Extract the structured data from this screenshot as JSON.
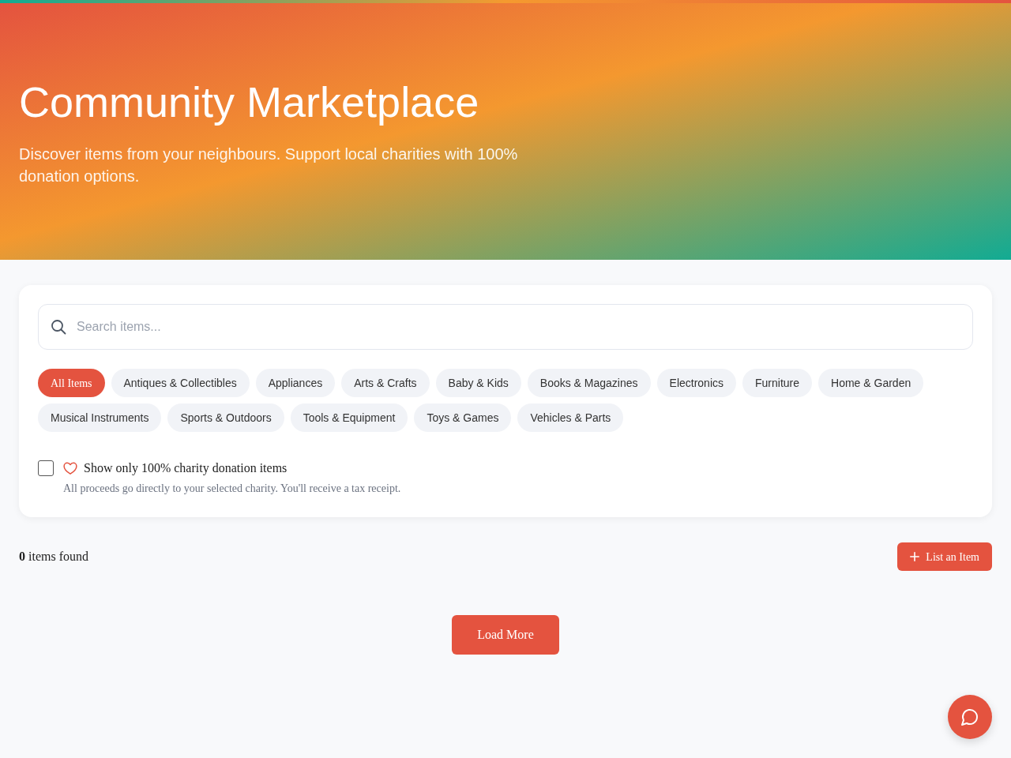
{
  "hero": {
    "title": "Community Marketplace",
    "subtitle": "Discover items from your neighbours. Support local charities with 100% donation options."
  },
  "search": {
    "placeholder": "Search items..."
  },
  "categories": [
    {
      "label": "All Items",
      "selected": true
    },
    {
      "label": "Antiques & Collectibles",
      "selected": false
    },
    {
      "label": "Appliances",
      "selected": false
    },
    {
      "label": "Arts & Crafts",
      "selected": false
    },
    {
      "label": "Baby & Kids",
      "selected": false
    },
    {
      "label": "Books & Magazines",
      "selected": false
    },
    {
      "label": "Electronics",
      "selected": false
    },
    {
      "label": "Furniture",
      "selected": false
    },
    {
      "label": "Home & Garden",
      "selected": false
    },
    {
      "label": "Musical Instruments",
      "selected": false
    },
    {
      "label": "Sports & Outdoors",
      "selected": false
    },
    {
      "label": "Tools & Equipment",
      "selected": false
    },
    {
      "label": "Toys & Games",
      "selected": false
    },
    {
      "label": "Vehicles & Parts",
      "selected": false
    }
  ],
  "charity_filter": {
    "label": "Show only 100% charity donation items",
    "checked": false,
    "description": "All proceeds go directly to your selected charity. You'll receive a tax receipt."
  },
  "results": {
    "count_text": "**0** items found",
    "list_button": "List an Item"
  },
  "load_more": "Load More"
}
